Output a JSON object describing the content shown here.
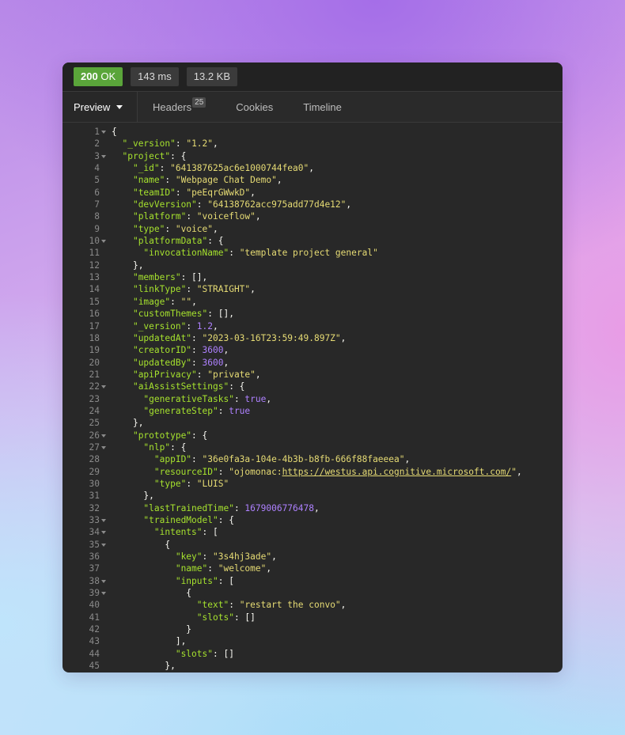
{
  "status": {
    "code": "200",
    "text": "OK",
    "time": "143 ms",
    "size": "13.2 KB"
  },
  "tabs": {
    "preview": "Preview",
    "headers": "Headers",
    "headers_count": "25",
    "cookies": "Cookies",
    "timeline": "Timeline"
  },
  "colors": {
    "status_ok": "#5aa53a",
    "key": "#a6e22e",
    "string": "#e6db74",
    "number": "#ae81ff",
    "panel": "#282828"
  },
  "code_lines": [
    {
      "n": "1",
      "fold": true,
      "indent": 0,
      "t": [
        [
          "p",
          "{"
        ]
      ]
    },
    {
      "n": "2",
      "indent": 1,
      "t": [
        [
          "k",
          "\"_version\""
        ],
        [
          "p",
          ": "
        ],
        [
          "s",
          "\"1.2\""
        ],
        [
          "p",
          ","
        ]
      ]
    },
    {
      "n": "3",
      "fold": true,
      "indent": 1,
      "t": [
        [
          "k",
          "\"project\""
        ],
        [
          "p",
          ": {"
        ]
      ]
    },
    {
      "n": "4",
      "indent": 2,
      "t": [
        [
          "k",
          "\"_id\""
        ],
        [
          "p",
          ": "
        ],
        [
          "s",
          "\"641387625ac6e1000744fea0\""
        ],
        [
          "p",
          ","
        ]
      ]
    },
    {
      "n": "5",
      "indent": 2,
      "t": [
        [
          "k",
          "\"name\""
        ],
        [
          "p",
          ": "
        ],
        [
          "s",
          "\"Webpage Chat Demo\""
        ],
        [
          "p",
          ","
        ]
      ]
    },
    {
      "n": "6",
      "indent": 2,
      "t": [
        [
          "k",
          "\"teamID\""
        ],
        [
          "p",
          ": "
        ],
        [
          "s",
          "\"peEqrGWwkD\""
        ],
        [
          "p",
          ","
        ]
      ]
    },
    {
      "n": "7",
      "indent": 2,
      "t": [
        [
          "k",
          "\"devVersion\""
        ],
        [
          "p",
          ": "
        ],
        [
          "s",
          "\"64138762acc975add77d4e12\""
        ],
        [
          "p",
          ","
        ]
      ]
    },
    {
      "n": "8",
      "indent": 2,
      "t": [
        [
          "k",
          "\"platform\""
        ],
        [
          "p",
          ": "
        ],
        [
          "s",
          "\"voiceflow\""
        ],
        [
          "p",
          ","
        ]
      ]
    },
    {
      "n": "9",
      "indent": 2,
      "t": [
        [
          "k",
          "\"type\""
        ],
        [
          "p",
          ": "
        ],
        [
          "s",
          "\"voice\""
        ],
        [
          "p",
          ","
        ]
      ]
    },
    {
      "n": "10",
      "fold": true,
      "indent": 2,
      "t": [
        [
          "k",
          "\"platformData\""
        ],
        [
          "p",
          ": {"
        ]
      ]
    },
    {
      "n": "11",
      "indent": 3,
      "t": [
        [
          "k",
          "\"invocationName\""
        ],
        [
          "p",
          ": "
        ],
        [
          "s",
          "\"template project general\""
        ]
      ]
    },
    {
      "n": "12",
      "indent": 2,
      "t": [
        [
          "p",
          "},"
        ]
      ]
    },
    {
      "n": "13",
      "indent": 2,
      "t": [
        [
          "k",
          "\"members\""
        ],
        [
          "p",
          ": [],"
        ]
      ]
    },
    {
      "n": "14",
      "indent": 2,
      "t": [
        [
          "k",
          "\"linkType\""
        ],
        [
          "p",
          ": "
        ],
        [
          "s",
          "\"STRAIGHT\""
        ],
        [
          "p",
          ","
        ]
      ]
    },
    {
      "n": "15",
      "indent": 2,
      "t": [
        [
          "k",
          "\"image\""
        ],
        [
          "p",
          ": "
        ],
        [
          "s",
          "\"\""
        ],
        [
          "p",
          ","
        ]
      ]
    },
    {
      "n": "16",
      "indent": 2,
      "t": [
        [
          "k",
          "\"customThemes\""
        ],
        [
          "p",
          ": [],"
        ]
      ]
    },
    {
      "n": "17",
      "indent": 2,
      "t": [
        [
          "k",
          "\"_version\""
        ],
        [
          "p",
          ": "
        ],
        [
          "n",
          "1.2"
        ],
        [
          "p",
          ","
        ]
      ]
    },
    {
      "n": "18",
      "indent": 2,
      "t": [
        [
          "k",
          "\"updatedAt\""
        ],
        [
          "p",
          ": "
        ],
        [
          "s",
          "\"2023-03-16T23:59:49.897Z\""
        ],
        [
          "p",
          ","
        ]
      ]
    },
    {
      "n": "19",
      "indent": 2,
      "t": [
        [
          "k",
          "\"creatorID\""
        ],
        [
          "p",
          ": "
        ],
        [
          "n",
          "3600"
        ],
        [
          "p",
          ","
        ]
      ]
    },
    {
      "n": "20",
      "indent": 2,
      "t": [
        [
          "k",
          "\"updatedBy\""
        ],
        [
          "p",
          ": "
        ],
        [
          "n",
          "3600"
        ],
        [
          "p",
          ","
        ]
      ]
    },
    {
      "n": "21",
      "indent": 2,
      "t": [
        [
          "k",
          "\"apiPrivacy\""
        ],
        [
          "p",
          ": "
        ],
        [
          "s",
          "\"private\""
        ],
        [
          "p",
          ","
        ]
      ]
    },
    {
      "n": "22",
      "fold": true,
      "indent": 2,
      "t": [
        [
          "k",
          "\"aiAssistSettings\""
        ],
        [
          "p",
          ": {"
        ]
      ]
    },
    {
      "n": "23",
      "indent": 3,
      "t": [
        [
          "k",
          "\"generativeTasks\""
        ],
        [
          "p",
          ": "
        ],
        [
          "b",
          "true"
        ],
        [
          "p",
          ","
        ]
      ]
    },
    {
      "n": "24",
      "indent": 3,
      "t": [
        [
          "k",
          "\"generateStep\""
        ],
        [
          "p",
          ": "
        ],
        [
          "b",
          "true"
        ]
      ]
    },
    {
      "n": "25",
      "indent": 2,
      "t": [
        [
          "p",
          "},"
        ]
      ]
    },
    {
      "n": "26",
      "fold": true,
      "indent": 2,
      "t": [
        [
          "k",
          "\"prototype\""
        ],
        [
          "p",
          ": {"
        ]
      ]
    },
    {
      "n": "27",
      "fold": true,
      "indent": 3,
      "t": [
        [
          "k",
          "\"nlp\""
        ],
        [
          "p",
          ": {"
        ]
      ]
    },
    {
      "n": "28",
      "indent": 4,
      "t": [
        [
          "k",
          "\"appID\""
        ],
        [
          "p",
          ": "
        ],
        [
          "s",
          "\"36e0fa3a-104e-4b3b-b8fb-666f88faeeea\""
        ],
        [
          "p",
          ","
        ]
      ]
    },
    {
      "n": "29",
      "indent": 4,
      "t": [
        [
          "k",
          "\"resourceID\""
        ],
        [
          "p",
          ": "
        ],
        [
          "s",
          "\"ojomonac:"
        ],
        [
          "su",
          "https://westus.api.cognitive.microsoft.com/"
        ],
        [
          "s",
          "\""
        ],
        [
          "p",
          ","
        ]
      ]
    },
    {
      "n": "30",
      "indent": 4,
      "t": [
        [
          "k",
          "\"type\""
        ],
        [
          "p",
          ": "
        ],
        [
          "s",
          "\"LUIS\""
        ]
      ]
    },
    {
      "n": "31",
      "indent": 3,
      "t": [
        [
          "p",
          "},"
        ]
      ]
    },
    {
      "n": "32",
      "indent": 3,
      "t": [
        [
          "k",
          "\"lastTrainedTime\""
        ],
        [
          "p",
          ": "
        ],
        [
          "n",
          "1679006776478"
        ],
        [
          "p",
          ","
        ]
      ]
    },
    {
      "n": "33",
      "fold": true,
      "indent": 3,
      "t": [
        [
          "k",
          "\"trainedModel\""
        ],
        [
          "p",
          ": {"
        ]
      ]
    },
    {
      "n": "34",
      "fold": true,
      "indent": 4,
      "t": [
        [
          "k",
          "\"intents\""
        ],
        [
          "p",
          ": ["
        ]
      ]
    },
    {
      "n": "35",
      "fold": true,
      "indent": 5,
      "t": [
        [
          "p",
          "{"
        ]
      ]
    },
    {
      "n": "36",
      "indent": 6,
      "t": [
        [
          "k",
          "\"key\""
        ],
        [
          "p",
          ": "
        ],
        [
          "s",
          "\"3s4hj3ade\""
        ],
        [
          "p",
          ","
        ]
      ]
    },
    {
      "n": "37",
      "indent": 6,
      "t": [
        [
          "k",
          "\"name\""
        ],
        [
          "p",
          ": "
        ],
        [
          "s",
          "\"welcome\""
        ],
        [
          "p",
          ","
        ]
      ]
    },
    {
      "n": "38",
      "fold": true,
      "indent": 6,
      "t": [
        [
          "k",
          "\"inputs\""
        ],
        [
          "p",
          ": ["
        ]
      ]
    },
    {
      "n": "39",
      "fold": true,
      "indent": 7,
      "t": [
        [
          "p",
          "{"
        ]
      ]
    },
    {
      "n": "40",
      "indent": 8,
      "t": [
        [
          "k",
          "\"text\""
        ],
        [
          "p",
          ": "
        ],
        [
          "s",
          "\"restart the convo\""
        ],
        [
          "p",
          ","
        ]
      ]
    },
    {
      "n": "41",
      "indent": 8,
      "t": [
        [
          "k",
          "\"slots\""
        ],
        [
          "p",
          ": []"
        ]
      ]
    },
    {
      "n": "42",
      "indent": 7,
      "t": [
        [
          "p",
          "}"
        ]
      ]
    },
    {
      "n": "43",
      "indent": 6,
      "t": [
        [
          "p",
          "],"
        ]
      ]
    },
    {
      "n": "44",
      "indent": 6,
      "t": [
        [
          "k",
          "\"slots\""
        ],
        [
          "p",
          ": []"
        ]
      ]
    },
    {
      "n": "45",
      "indent": 5,
      "t": [
        [
          "p",
          "},"
        ]
      ]
    }
  ]
}
